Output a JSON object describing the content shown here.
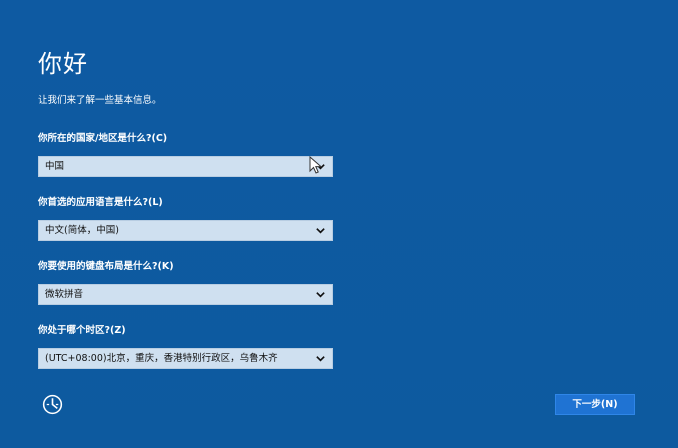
{
  "page": {
    "title": "你好",
    "subtitle": "让我们来了解一些基本信息。"
  },
  "fields": [
    {
      "label": "你所在的国家/地区是什么?(C)",
      "value": "中国"
    },
    {
      "label": "你首选的应用语言是什么?(L)",
      "value": "中文(简体，中国)"
    },
    {
      "label": "你要使用的键盘布局是什么?(K)",
      "value": "微软拼音"
    },
    {
      "label": "你处于哪个时区?(Z)",
      "value": "(UTC+08:00)北京，重庆，香港特别行政区，乌鲁木齐"
    }
  ],
  "actions": {
    "next_label": "下一步(N)"
  },
  "icons": {
    "accessibility": "accessibility-icon",
    "dropdown": "chevron-down-icon",
    "cursor": "cursor-arrow-icon"
  },
  "colors": {
    "background": "#0f5aa0",
    "dropdown_background": "#cfe0f0",
    "next_button": "#1f73d3"
  }
}
